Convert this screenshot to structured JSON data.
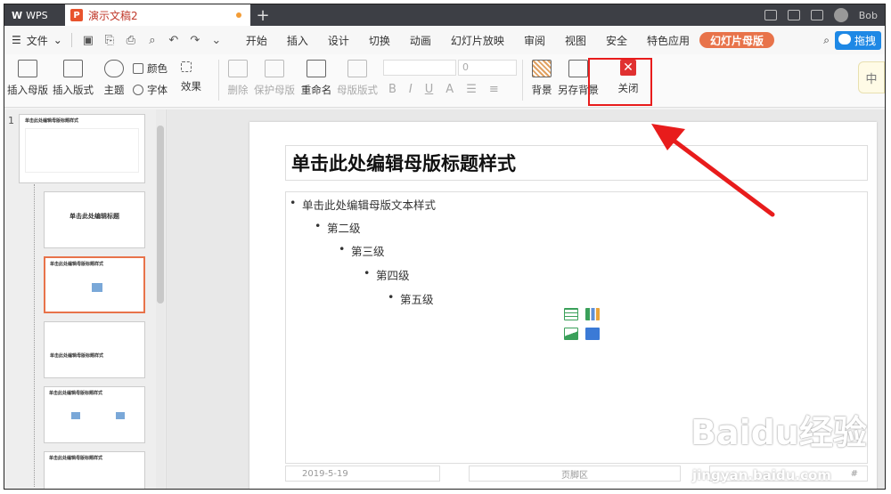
{
  "titlebar": {
    "app_name": "WPS",
    "doc_name": "演示文稿2",
    "new_tab": "+",
    "user_name": "Bob"
  },
  "menubar": {
    "file_label": "文件",
    "tabs": [
      "开始",
      "插入",
      "设计",
      "切换",
      "动画",
      "幻灯片放映",
      "审阅",
      "视图",
      "安全",
      "特色应用",
      "幻灯片母版"
    ],
    "active_tab": "幻灯片母版",
    "baidu_button": "拖拽"
  },
  "ribbon": {
    "insert_master": "插入母版",
    "insert_layout": "插入版式",
    "theme": "主题",
    "color": "颜色",
    "font": "字体",
    "effect": "效果",
    "delete": "删除",
    "protect_master": "保护母版",
    "rename": "重命名",
    "master_layout": "母版版式",
    "font_size": "0",
    "background": "背景",
    "save_background": "另存背景",
    "close": "关闭",
    "side_widget": "中"
  },
  "thumbs": {
    "first_number": "1",
    "t1_title": "单击此处编辑母版标题样式",
    "t2_title": "单击此处编辑标题",
    "t3_title": "单击此处编辑母版标题样式",
    "t4_title": "单击此处编辑母版标题样式",
    "t5_title": "单击此处编辑母版标题样式",
    "t6_title": "单击此处编辑母版标题样式"
  },
  "slide": {
    "title": "单击此处编辑母版标题样式",
    "levels": [
      "单击此处编辑母版文本样式",
      "第二级",
      "第三级",
      "第四级",
      "第五级"
    ],
    "footer_date": "2019-5-19",
    "footer_text": "页脚区",
    "footer_num": "#"
  },
  "watermark": {
    "brand": "Baidu经验",
    "url": "jingyan.baidu.com"
  },
  "colors": {
    "accent": "#e8734a",
    "highlight": "#e81c1c",
    "close_icon": "#e03030"
  }
}
